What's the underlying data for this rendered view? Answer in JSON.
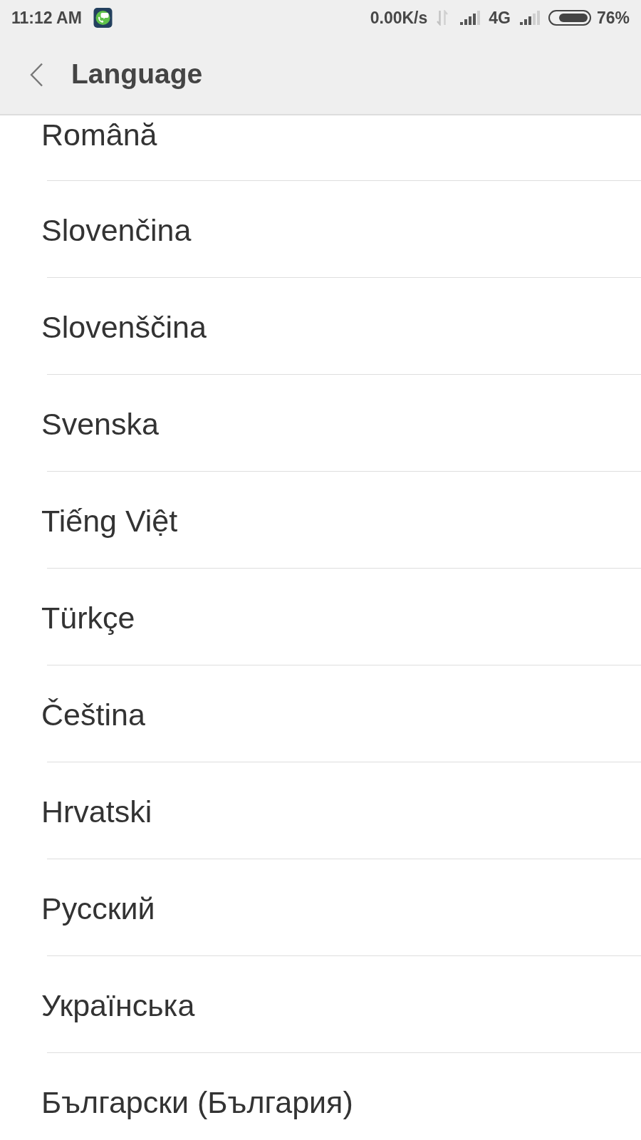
{
  "status_bar": {
    "time": "11:12 AM",
    "net_speed": "0.00K/s",
    "network_type": "4G",
    "battery_text": "76%"
  },
  "header": {
    "title": "Language"
  },
  "languages": [
    {
      "name": "Română"
    },
    {
      "name": "Slovenčina"
    },
    {
      "name": "Slovenščina"
    },
    {
      "name": "Svenska"
    },
    {
      "name": "Tiếng Việt"
    },
    {
      "name": "Türkçe"
    },
    {
      "name": "Čeština"
    },
    {
      "name": "Hrvatski"
    },
    {
      "name": "Русский"
    },
    {
      "name": "Українська"
    },
    {
      "name": "Български (България)"
    }
  ]
}
